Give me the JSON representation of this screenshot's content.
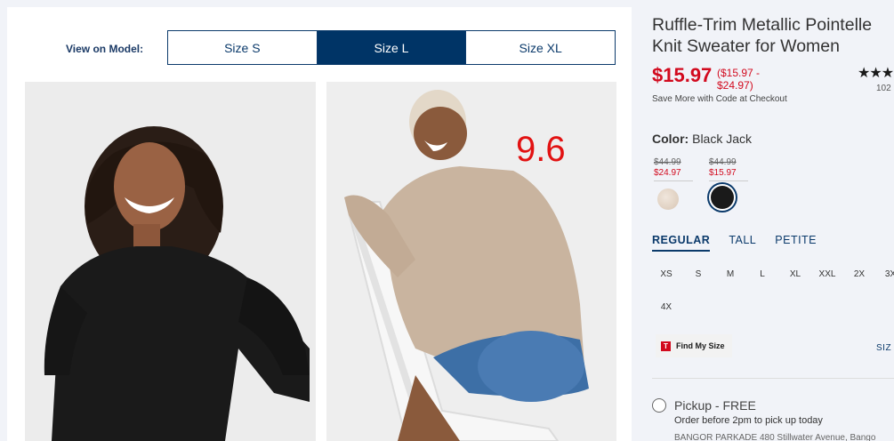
{
  "gallery": {
    "view_on_model_label": "View on Model:",
    "size_options": [
      "Size S",
      "Size L",
      "Size XL"
    ],
    "selected_size": "Size L",
    "overlay_rating": "9.6"
  },
  "product": {
    "title_line1": "Ruffle-Trim Metallic Pointelle",
    "title_line2": "Knit Sweater for Women",
    "price": "$15.97",
    "price_range_line1": "($15.97 -",
    "price_range_line2": "$24.97)",
    "stars": "★★★",
    "review_count": "102",
    "save_more": "Save More with Code at Checkout",
    "color_label": "Color:",
    "color_value": "Black Jack",
    "swatches": [
      {
        "old_price": "$44.99",
        "new_price": "$24.97",
        "color": "#e2d4c6",
        "name": "tan"
      },
      {
        "old_price": "$44.99",
        "new_price": "$15.97",
        "color": "#1a1a1a",
        "name": "black-jack"
      }
    ],
    "fit_tabs": [
      "REGULAR",
      "TALL",
      "PETITE"
    ],
    "active_fit": "REGULAR",
    "sizes": [
      "XS",
      "S",
      "M",
      "L",
      "XL",
      "XXL",
      "2X",
      "3X",
      "4X"
    ],
    "find_my_size_icon": "T",
    "find_my_size": "Find My Size",
    "size_chart": "SIZ",
    "pickup_label": "Pickup - FREE",
    "pickup_note": "Order before 2pm to pick up today",
    "store_line": "BANGOR PARKADE 480 Stillwater Avenue, Bango"
  },
  "colors": {
    "navy": "#003466",
    "price_red": "#d20a1e",
    "overlay_red": "#e21212"
  }
}
